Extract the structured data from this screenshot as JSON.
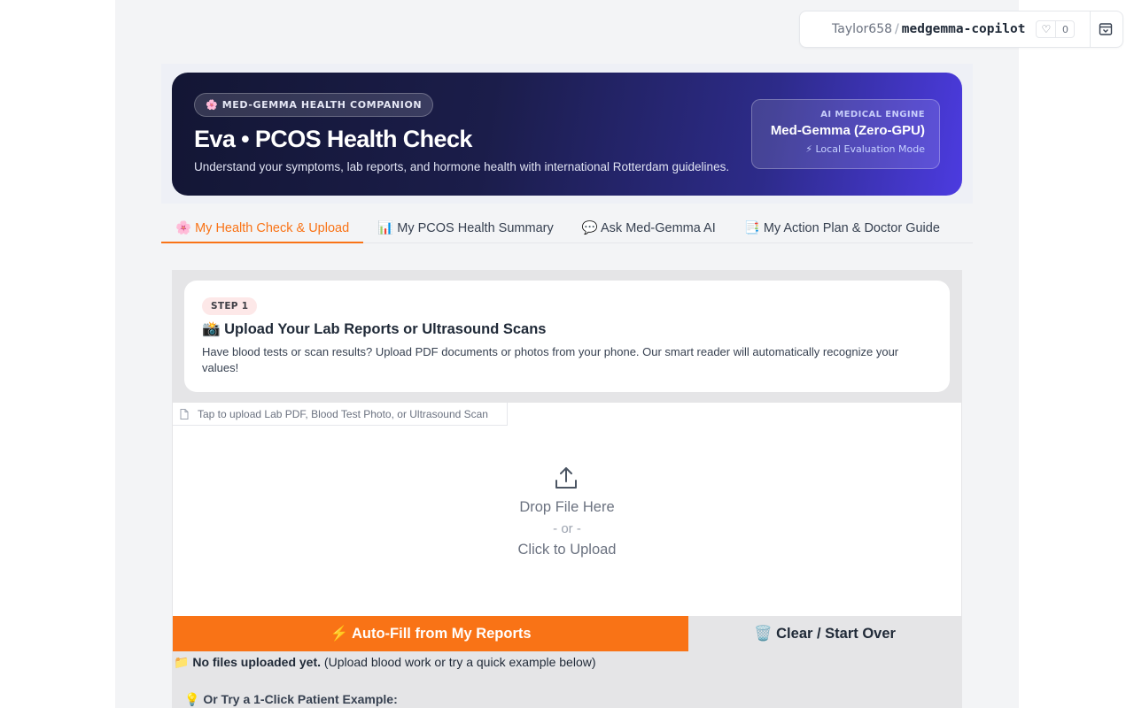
{
  "space": {
    "owner": "Taylor658",
    "separator": "/",
    "repo": "medgemma-copilot",
    "likes": "0"
  },
  "hero": {
    "pill": "🌸 MED-GEMMA HEALTH COMPANION",
    "title": "Eva • PCOS Health Check",
    "subtitle": "Understand your symptoms, lab reports, and hormone health with international Rotterdam guidelines.",
    "engine_label": "AI MEDICAL ENGINE",
    "engine_name": "Med-Gemma (Zero-GPU)",
    "engine_mode": "⚡ Local Evaluation Mode"
  },
  "tabs": [
    {
      "label": "🌸 My Health Check & Upload"
    },
    {
      "label": "📊 My PCOS Health Summary"
    },
    {
      "label": "💬 Ask Med-Gemma AI"
    },
    {
      "label": "📑 My Action Plan & Doctor Guide"
    }
  ],
  "step": {
    "pill": "STEP 1",
    "title": "📸 Upload Your Lab Reports or Ultrasound Scans",
    "description": "Have blood tests or scan results? Upload PDF documents or photos from your phone. Our smart reader will automatically recognize your values!"
  },
  "upload": {
    "label": "Tap to upload Lab PDF, Blood Test Photo, or Ultrasound Scan",
    "drop_text": "Drop File Here",
    "or_text": "- or -",
    "click_text": "Click to Upload"
  },
  "buttons": {
    "autofill": "⚡ Auto-Fill from My Reports",
    "clear": "🗑️ Clear / Start Over"
  },
  "status": {
    "icon": "📁",
    "bold": "No files uploaded yet.",
    "rest": " (Upload blood work or try a quick example below)"
  },
  "examples_heading": "💡 Or Try a 1-Click Patient Example:",
  "colors": {
    "accent": "#f97316",
    "hero_start": "#131634",
    "hero_end": "#4c3be0"
  }
}
